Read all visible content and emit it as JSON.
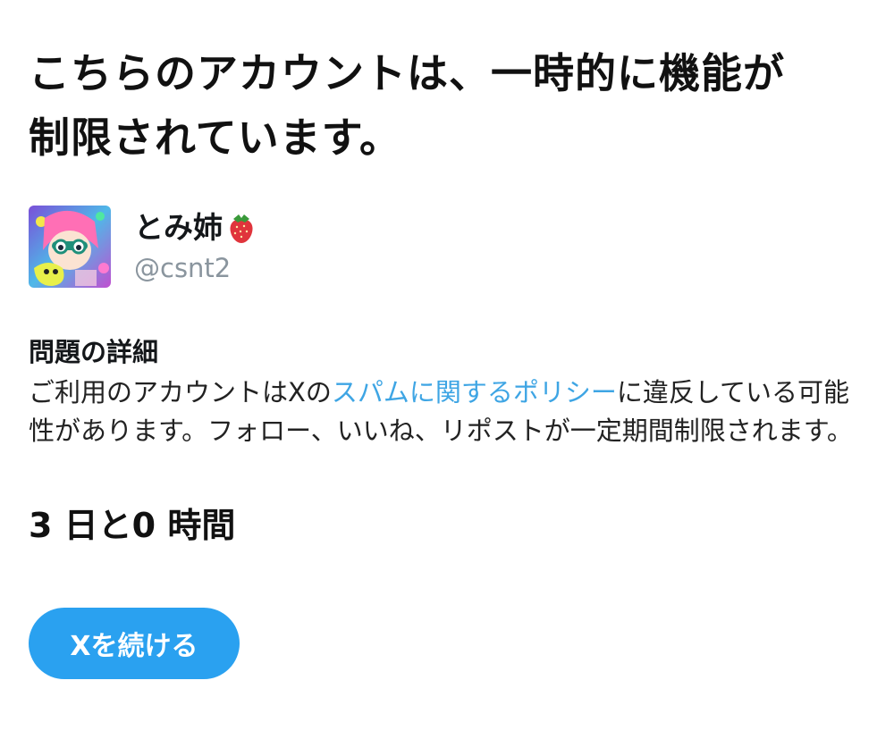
{
  "notice": {
    "headline_line1": "こちらのアカウントは、一時的に機能が",
    "headline_line2": "制限されています。"
  },
  "account": {
    "display_name": "とみ姉",
    "name_emoji": "strawberry-emoji",
    "handle": "@csnt2",
    "avatar_icon": "avatar-image"
  },
  "issue": {
    "title": "問題の詳細",
    "text_before_link": "ご利用のアカウントはXの",
    "link_text": "スパムに関するポリシー",
    "text_after_link": "に違反している可能性があります。フォロー、いいね、リポストが一定期間制限されます。"
  },
  "restriction": {
    "duration": "3 日と0 時間"
  },
  "actions": {
    "continue_label": "Xを続ける"
  },
  "colors": {
    "link": "#3ea5e4",
    "button": "#2aa1f0",
    "handle": "#8a959e"
  }
}
